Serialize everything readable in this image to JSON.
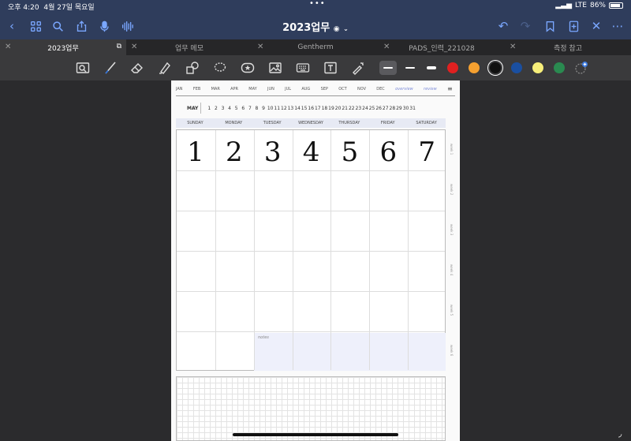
{
  "status": {
    "time": "오후 4:20",
    "date": "4월 27일 목요일",
    "signal": "LTE",
    "battery": "86%",
    "battery_level": 0.86
  },
  "nav": {
    "title": "2023업무"
  },
  "tabs": [
    {
      "label": "2023업무"
    },
    {
      "label": "업무 메모"
    },
    {
      "label": "Gentherm"
    },
    {
      "label": "PADS_인력_221028"
    },
    {
      "label": "측정 참고"
    }
  ],
  "toolbar": {
    "colors": [
      "#e02020",
      "#f5a030",
      "#111111",
      "#1a4fa0",
      "#f7ef7a",
      "#2a8a50"
    ]
  },
  "planner": {
    "months": [
      "JAN",
      "FEB",
      "MAR",
      "APR",
      "MAY",
      "JUN",
      "JUL",
      "AUG",
      "SEP",
      "OCT",
      "NOV",
      "DEC"
    ],
    "overview": "overview",
    "review": "review",
    "current_month": "MAY",
    "dates": [
      "1",
      "2",
      "3",
      "4",
      "5",
      "6",
      "7",
      "8",
      "9",
      "10",
      "11",
      "12",
      "13",
      "14",
      "15",
      "16",
      "17",
      "18",
      "19",
      "20",
      "21",
      "22",
      "23",
      "24",
      "25",
      "26",
      "27",
      "28",
      "29",
      "30",
      "31"
    ],
    "weekdays": [
      "SUNDAY",
      "MONDAY",
      "TUESDAY",
      "WEDNESDAY",
      "THURSDAY",
      "FRIDAY",
      "SATURDAY"
    ],
    "handwritten": [
      "1",
      "2",
      "3",
      "4",
      "5",
      "6",
      "7"
    ],
    "notes_label": "notes",
    "week_labels": [
      "week 1",
      "week 2",
      "week 3",
      "week 4",
      "week 5",
      "week 6"
    ]
  }
}
